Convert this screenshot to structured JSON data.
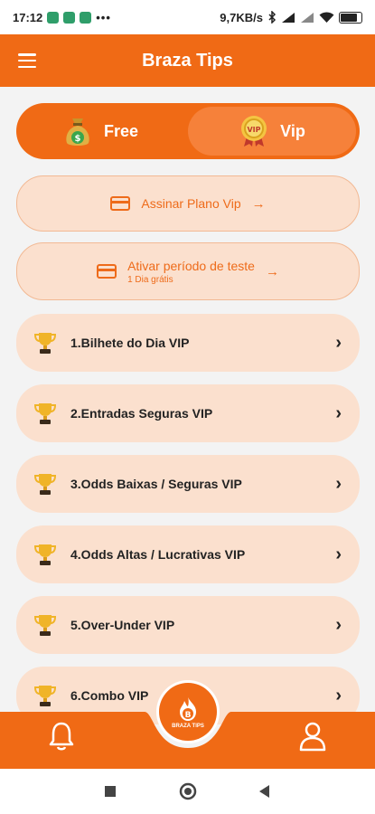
{
  "status_bar": {
    "time": "17:12",
    "network": "9,7KB/s",
    "battery": "86"
  },
  "app_bar": {
    "title": "Braza Tips"
  },
  "toggle": {
    "free_label": "Free",
    "vip_label": "Vip",
    "active": "vip"
  },
  "subscribe": {
    "label": "Assinar Plano Vip"
  },
  "trial": {
    "label": "Ativar período de teste",
    "sublabel": "1 Dia grátis"
  },
  "menu": [
    {
      "label": "1.Bilhete do Dia VIP"
    },
    {
      "label": "2.Entradas Seguras VIP"
    },
    {
      "label": "3.Odds Baixas / Seguras VIP"
    },
    {
      "label": "4.Odds Altas / Lucrativas VIP"
    },
    {
      "label": "5.Over-Under VIP"
    },
    {
      "label": "6.Combo VIP"
    }
  ],
  "fab": {
    "text": "BRAZA TIPS"
  },
  "colors": {
    "primary": "#f06a15",
    "card": "#fbe0ce",
    "background": "#f3f3f3"
  }
}
